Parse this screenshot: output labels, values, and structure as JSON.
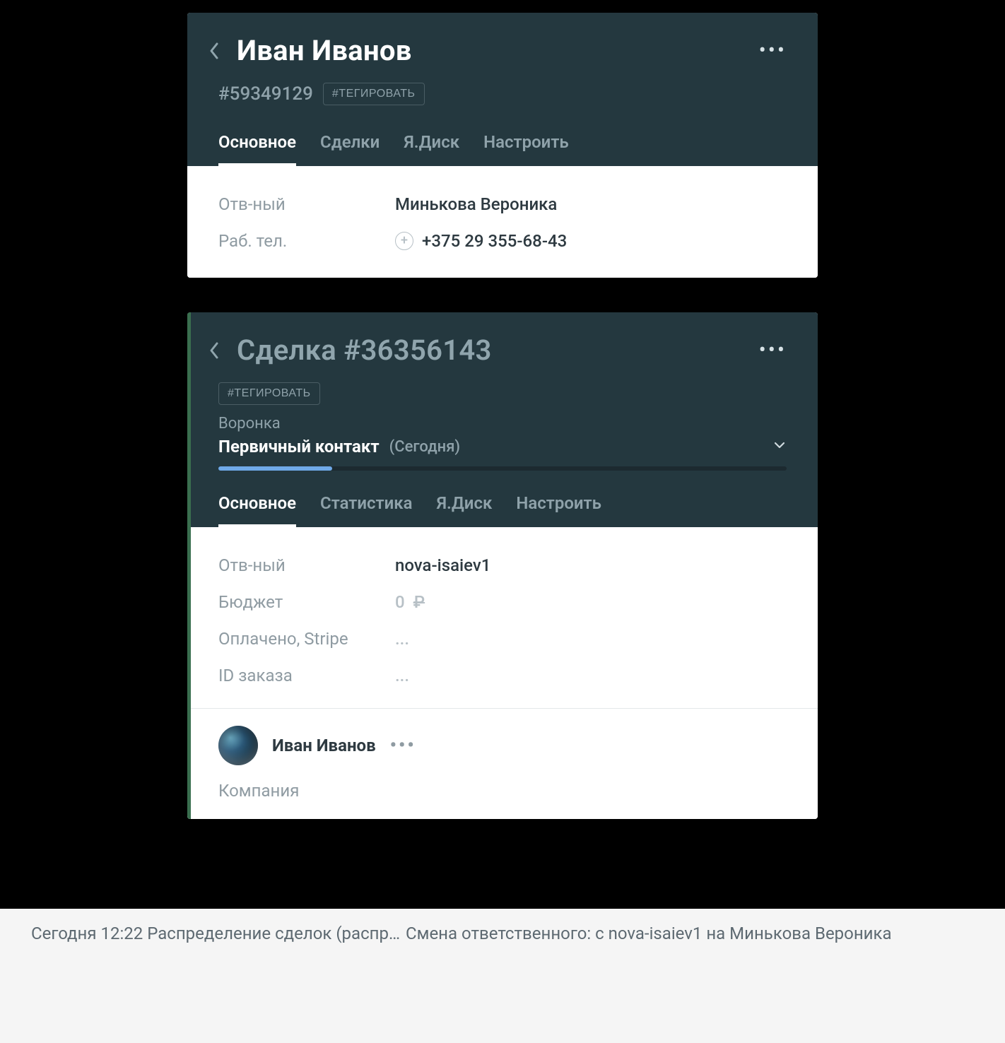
{
  "contact_card": {
    "title": "Иван Иванов",
    "id_hash": "#59349129",
    "tag_button": "#ТЕГИРОВАТЬ",
    "tabs": [
      "Основное",
      "Сделки",
      "Я.Диск",
      "Настроить"
    ],
    "active_tab_index": 0,
    "fields": {
      "responsible_label": "Отв-ный",
      "responsible_value": "Минькова Вероника",
      "work_phone_label": "Раб. тел.",
      "work_phone_value": "+375 29 355-68-43"
    }
  },
  "deal_card": {
    "title": "Сделка #36356143",
    "tag_button": "#ТЕГИРОВАТЬ",
    "pipeline_label": "Воронка",
    "pipeline_stage": "Первичный контакт",
    "pipeline_date": "(Сегодня)",
    "progress_percent": 20,
    "tabs": [
      "Основное",
      "Статистика",
      "Я.Диск",
      "Настроить"
    ],
    "active_tab_index": 0,
    "fields": {
      "responsible_label": "Отв-ный",
      "responsible_value": "nova-isaiev1",
      "budget_label": "Бюджет",
      "budget_value": "0",
      "budget_currency": "₽",
      "paid_stripe_label": "Оплачено, Stripe",
      "paid_stripe_value": "...",
      "order_id_label": "ID заказа",
      "order_id_value": "..."
    },
    "contact": {
      "name": "Иван Иванов",
      "company_label": "Компания"
    }
  },
  "footer": {
    "seg1": "Сегодня 12:22 Распределение сделок (распр…",
    "seg2": "Смена ответственного: с nova-isaiev1 на Минькова Вероника"
  }
}
